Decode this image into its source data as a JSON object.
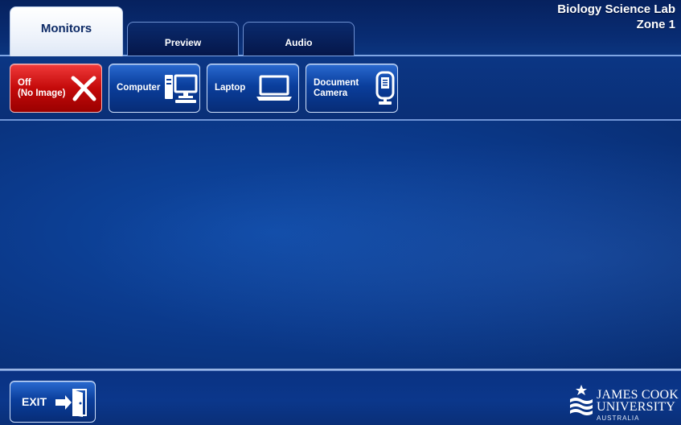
{
  "tabs": [
    {
      "label": "Monitors",
      "active": true
    },
    {
      "label": "Preview",
      "active": false
    },
    {
      "label": "Audio",
      "active": false
    }
  ],
  "location": {
    "room": "Biology Science Lab",
    "zone": "Zone 1"
  },
  "sources": [
    {
      "label": "Off\n(No Image)",
      "icon": "close-x-icon",
      "color": "#d11212"
    },
    {
      "label": "Computer",
      "icon": "desktop-computer-icon",
      "color": "#0b3f9e"
    },
    {
      "label": "Laptop",
      "icon": "laptop-icon",
      "color": "#0b3f9e"
    },
    {
      "label": "Document\nCamera",
      "icon": "document-camera-icon",
      "color": "#0b3f9e"
    }
  ],
  "footer": {
    "exit_label": "EXIT",
    "exit_icon": "exit-door-icon",
    "logo": {
      "line1": "JAMES COOK",
      "line2": "UNIVERSITY",
      "line3": "AUSTRALIA"
    }
  }
}
